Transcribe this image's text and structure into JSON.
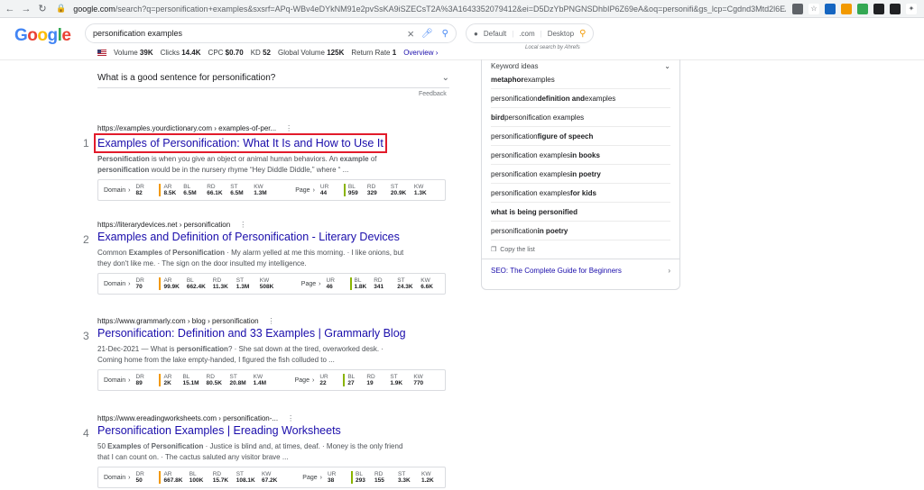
{
  "browser": {
    "url_host": "google.com",
    "url_path": "/search?q=personification+examples&sxsrf=APq-WBv4eDYkNM91e2pvSsKA9iSZECsT2A%3A1643352079412&ei=D5DzYbPNGNSDhbIP6Z69eA&oq=personifi&gs_lcp=Cgdnd3Mtd2l6EAMYATIECCMQ..."
  },
  "logo": [
    "G",
    "o",
    "o",
    "g",
    "l",
    "e"
  ],
  "search": {
    "query": "personification examples"
  },
  "local": {
    "country": "Default",
    "domain": ".com",
    "device": "Desktop",
    "caption": "Local search by Ahrefs"
  },
  "keyword_bar": {
    "volume_label": "Volume",
    "volume": "39K",
    "clicks_label": "Clicks",
    "clicks": "14.4K",
    "cpc_label": "CPC",
    "cpc": "$0.70",
    "kd_label": "KD",
    "kd": "52",
    "global_label": "Global Volume",
    "global": "125K",
    "return_label": "Return Rate",
    "return": "1",
    "overview": "Overview ›"
  },
  "paa": {
    "question": "What is a good sentence for personification?",
    "feedback": "Feedback"
  },
  "metric_labels": {
    "domain": "Domain",
    "page": "Page",
    "dr": "DR",
    "ar": "AR",
    "bl": "BL",
    "rd": "RD",
    "st": "ST",
    "kw": "KW",
    "ur": "UR"
  },
  "results": [
    {
      "num": "1",
      "cite": "https://examples.yourdictionary.com › examples-of-per...",
      "title": "Examples of Personification: What It Is and How to Use It",
      "snippet_1": "Personification",
      "snippet_2": " is when you give an object or animal human behaviors. An ",
      "snippet_3": "example",
      "snippet_4": " of ",
      "snippet_5": "personification",
      "snippet_6": " would be in the nursery rhyme “Hey Diddle Diddle,” where “ ...",
      "domain": {
        "dr": "82",
        "ar": "8.5K",
        "bl": "6.5M",
        "rd": "66.1K",
        "st": "6.5M",
        "kw": "1.3M"
      },
      "page": {
        "ur": "44",
        "bl": "959",
        "rd": "329",
        "st": "20.9K",
        "kw": "1.3K"
      }
    },
    {
      "num": "2",
      "cite": "https://literarydevices.net › personification",
      "title": "Examples and Definition of Personification - Literary Devices",
      "snippet_1": "Common ",
      "snippet_2": "Examples",
      "snippet_3": " of ",
      "snippet_4": "Personification",
      "snippet_5": " · My alarm yelled at me this morning. · I like onions, but",
      "snippet_6": "they don't like me. · The sign on the door insulted my intelligence.",
      "domain": {
        "dr": "70",
        "ar": "99.9K",
        "bl": "662.4K",
        "rd": "11.3K",
        "st": "1.3M",
        "kw": "508K"
      },
      "page": {
        "ur": "46",
        "bl": "1.8K",
        "rd": "341",
        "st": "24.3K",
        "kw": "6.6K"
      }
    },
    {
      "num": "3",
      "cite": "https://www.grammarly.com › blog › personification",
      "title": "Personification: Definition and 33 Examples | Grammarly Blog",
      "snippet_1": "21-Dec-2021 — What is ",
      "snippet_2": "personification",
      "snippet_3": "? · She sat down at the tired, overworked desk. ·",
      "snippet_4": "Coming home from the lake empty-handed, I figured the fish colluded to ...",
      "domain": {
        "dr": "89",
        "ar": "2K",
        "bl": "15.1M",
        "rd": "80.5K",
        "st": "20.8M",
        "kw": "1.4M"
      },
      "page": {
        "ur": "22",
        "bl": "27",
        "rd": "19",
        "st": "1.9K",
        "kw": "770"
      }
    },
    {
      "num": "4",
      "cite": "https://www.ereadingworksheets.com › personification-...",
      "title": "Personification Examples | Ereading Worksheets",
      "snippet_1": "50 ",
      "snippet_2": "Examples",
      "snippet_3": " of ",
      "snippet_4": "Personification",
      "snippet_5": " · Justice is blind and, at times, deaf. · Money is the only friend",
      "snippet_6": "that I can count on. · The cactus saluted any visitor brave ...",
      "domain": {
        "dr": "50",
        "ar": "667.8K",
        "bl": "100K",
        "rd": "15.7K",
        "st": "108.1K",
        "kw": "67.2K"
      },
      "page": {
        "ur": "38",
        "bl": "293",
        "rd": "155",
        "st": "3.3K",
        "kw": "1.2K"
      }
    }
  ],
  "sidebar": {
    "header": "Keyword ideas",
    "items": [
      {
        "pre": "",
        "bold": "metaphor",
        "post": " examples"
      },
      {
        "pre": "personification ",
        "bold": "definition and",
        "post": " examples"
      },
      {
        "pre": "",
        "bold": "bird",
        "post": " personification examples"
      },
      {
        "pre": "personification ",
        "bold": "figure of speech",
        "post": ""
      },
      {
        "pre": "personification examples ",
        "bold": "in books",
        "post": ""
      },
      {
        "pre": "personification examples ",
        "bold": "in poetry",
        "post": ""
      },
      {
        "pre": "personification examples ",
        "bold": "for kids",
        "post": ""
      },
      {
        "pre": "",
        "bold": "what is being personified",
        "post": ""
      },
      {
        "pre": "personification ",
        "bold": "in poetry",
        "post": ""
      }
    ],
    "copy": "Copy the list",
    "footer_link": "SEO: The Complete Guide for Beginners"
  },
  "colors": {
    "link": "#1a0dab",
    "highlight_box": "#e21b2b",
    "ahrefs_orange": "#f29900"
  }
}
